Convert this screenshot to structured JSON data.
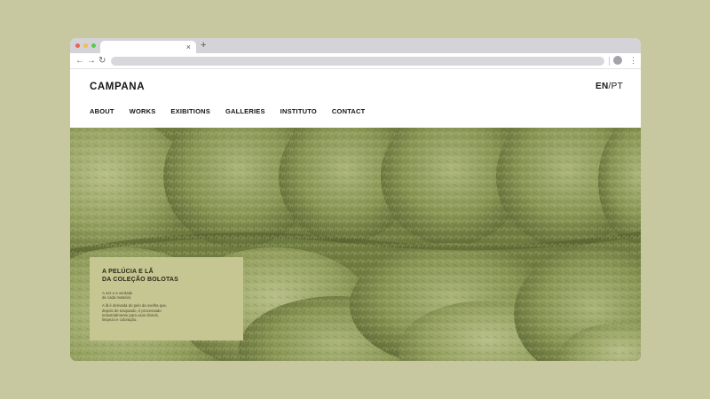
{
  "colors": {
    "page_background": "#c7c89f",
    "card_background": "#c6c692",
    "fur_green": "#7d8a4c"
  },
  "browser": {
    "window_dots": [
      "#f0605a",
      "#f4bd4f",
      "#5cc853"
    ],
    "tab_close": "×",
    "new_tab": "+",
    "nav": {
      "back": "←",
      "forward": "→",
      "reload": "↻"
    },
    "menu": "⋮"
  },
  "site": {
    "logo": "CAMPANA",
    "lang_active": "EN",
    "lang_sep": "/",
    "lang_other": "PT",
    "nav": [
      {
        "label": "ABOUT"
      },
      {
        "label": "WORKS"
      },
      {
        "label": "EXIBITIONS"
      },
      {
        "label": "GALLERIES"
      },
      {
        "label": "INSTITUTO"
      },
      {
        "label": "CONTACT"
      }
    ]
  },
  "card": {
    "title_line1": "A PELÚCIA E LÃ",
    "title_line2": "DA COLEÇÃO BOLOTAS",
    "sub_line1": "A voz e a verdade",
    "sub_line2": "de cada material.",
    "body_line1": "A lã é derivada do pelo da ovelha que,",
    "body_line2": "depois de tosquiado, é processado",
    "body_line3": "industrialmente para usos têxteis,",
    "body_line4": "limpeza e coloração."
  }
}
